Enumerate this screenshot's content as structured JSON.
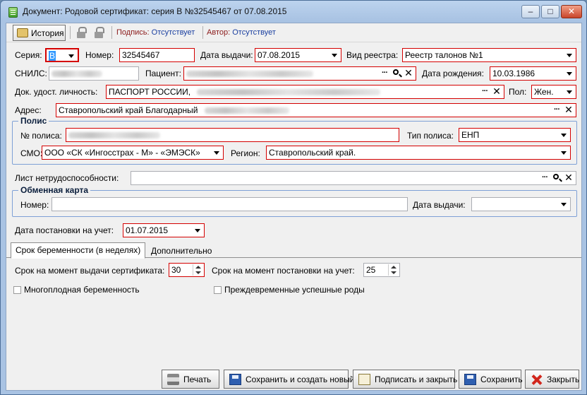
{
  "window": {
    "title": "Документ: Родовой сертификат: серия В №32545467 от 07.08.2015"
  },
  "toolbar": {
    "history_label": "История",
    "signature_label": "Подпись:",
    "signature_value": "Отсутствует",
    "author_label": "Автор:",
    "author_value": "Отсутствует"
  },
  "form": {
    "series_label": "Серия:",
    "series_value": "В",
    "number_label": "Номер:",
    "number_value": "32545467",
    "issue_date_label": "Дата выдачи:",
    "issue_date_value": "07.08.2015",
    "registry_label": "Вид реестра:",
    "registry_value": "Реестр талонов №1",
    "snils_label": "СНИЛС:",
    "patient_label": "Пациент:",
    "birth_date_label": "Дата рождения:",
    "birth_date_value": "10.03.1986",
    "id_doc_label": "Док. удост. личность:",
    "id_doc_value": "ПАСПОРТ РОССИИ,",
    "sex_label": "Пол:",
    "sex_value": "Жен.",
    "address_label": "Адрес:",
    "address_value": "Ставропольский край Благодарный"
  },
  "policy": {
    "title": "Полис",
    "number_label": "№ полиса:",
    "type_label": "Тип полиса:",
    "type_value": "ЕНП",
    "smo_label": "СМО:",
    "smo_value": "ООО «СК «Ингосстрах - М» - «ЭМЭСК»",
    "region_label": "Регион:",
    "region_value": "Ставропольский край."
  },
  "sick_leave_label": "Лист нетрудоспособности:",
  "exchange_card": {
    "title": "Обменная карта",
    "number_label": "Номер:",
    "issue_date_label": "Дата выдачи:"
  },
  "registration": {
    "label": "Дата постановки на учет:",
    "value": "01.07.2015"
  },
  "tabs": [
    {
      "label": "Срок беременности (в неделях)"
    },
    {
      "label": "Дополнительно"
    }
  ],
  "pregnancy": {
    "at_issue_label": "Срок на момент выдачи сертификата:",
    "at_issue_value": "30",
    "at_registration_label": "Срок на момент постановки на учет:",
    "at_registration_value": "25",
    "multiple_label": "Многоплодная беременность",
    "preterm_label": "Преждевременные успешные роды"
  },
  "buttons": {
    "print": "Печать",
    "save_new": "Сохранить и создать новый",
    "sign_close": "Подписать и закрыть",
    "save": "Сохранить",
    "close": "Закрыть"
  }
}
